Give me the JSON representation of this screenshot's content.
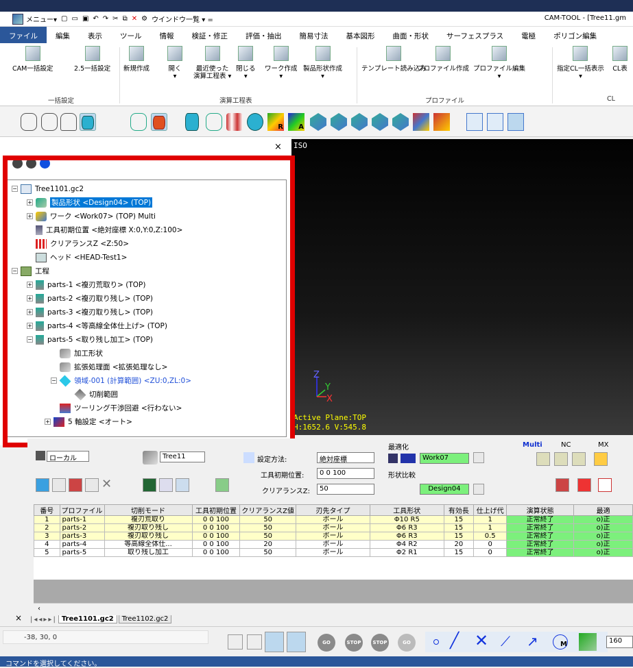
{
  "window": {
    "title": "CAM-TOOL - [Tree11.gm",
    "quick_access": [
      "メニュー▾",
      "ウインドウ一覧 ▾ ="
    ]
  },
  "ribbon": {
    "tabs": [
      "ファイル",
      "編集",
      "表示",
      "ツール",
      "情報",
      "検証・修正",
      "評価・抽出",
      "簡易寸法",
      "基本図形",
      "曲面・形状",
      "サーフェスプラス",
      "電極",
      "ポリゴン編集"
    ],
    "active_tab": "ファイル",
    "buttons": [
      {
        "label": "CAM一括設定",
        "label2": ""
      },
      {
        "label": "2.5一括設定",
        "label2": ""
      },
      {
        "label": "新規作成",
        "label2": ""
      },
      {
        "label": "開く",
        "label2": "▾"
      },
      {
        "label": "最近使った",
        "label2": "演算工程表 ▾"
      },
      {
        "label": "閉じる",
        "label2": "▾"
      },
      {
        "label": "ワーク作成",
        "label2": "▾"
      },
      {
        "label": "製品形状作成",
        "label2": "▾"
      },
      {
        "label": "テンプレート読み込み",
        "label2": ""
      },
      {
        "label": "プロファイル作成",
        "label2": ""
      },
      {
        "label": "プロファイル編集",
        "label2": "▾"
      },
      {
        "label": "指定CL一括表示",
        "label2": "▾"
      },
      {
        "label": "CL表",
        "label2": ""
      }
    ],
    "groups": [
      "一括設定",
      "演算工程表",
      "プロファイル",
      "CL"
    ]
  },
  "toolbar2_labels": [
    "R",
    "A"
  ],
  "tree_panel": {
    "close": "×",
    "nodes": [
      {
        "text": "Tree1101.gc2"
      },
      {
        "text": "製品形状 <Design04> (TOP)"
      },
      {
        "text": "ワーク <Work07> (TOP) Multi"
      },
      {
        "text": "工具初期位置 <絶対座標 X:0,Y:0,Z:100>"
      },
      {
        "text": "クリアランスZ <Z:50>"
      },
      {
        "text": "ヘッド <HEAD-Test1>"
      },
      {
        "text": "工程"
      },
      {
        "text": "parts-1 <複刃荒取り> (TOP)"
      },
      {
        "text": "parts-2 <複刃取り残し> (TOP)"
      },
      {
        "text": "parts-3 <複刃取り残し> (TOP)"
      },
      {
        "text": "parts-4 <等高線全体仕上げ> (TOP)"
      },
      {
        "text": "parts-5 <取り残し加工> (TOP)"
      },
      {
        "text": "加工形状"
      },
      {
        "text": "拡張処理面 <拡張処理なし>"
      },
      {
        "text": "領域-001 (計算範囲) <ZU:0,ZL:0>"
      },
      {
        "text": "切削範囲"
      },
      {
        "text": "ツーリング干渉回避 <行わない>"
      },
      {
        "text": "5 軸設定 <オート>"
      }
    ]
  },
  "viewport": {
    "view_name": "ISO",
    "plane_text": "Active Plane:TOP",
    "hv_text": "H:1652.6 V:545.8",
    "axis_x": "X",
    "axis_y": "Y",
    "axis_z": "Z"
  },
  "bottom": {
    "coord_system": "ローカル",
    "shape_name": "Tree11",
    "settings_method_label": "設定方法:",
    "settings_method_value": "絶対座標",
    "tool_init_label": "工具初期位置:",
    "tool_init_value": "0 0 100",
    "clearance_label": "クリアランスZ:",
    "clearance_value": "50",
    "optimize_label": "最適化",
    "work_value": "Work07",
    "compare_label": "形状比較",
    "design_value": "Design04",
    "multi_label": "Multi",
    "nc_label": "NC",
    "mx_label": "MX"
  },
  "table": {
    "headers": [
      "番号",
      "プロファイル",
      "切削モード",
      "工具初期位置",
      "クリアランスZ値",
      "刃先タイプ",
      "工具形状",
      "有効長",
      "仕上げ代",
      "演算状態",
      "最適"
    ],
    "rows": [
      [
        "1",
        "parts-1",
        "複刃荒取り",
        "0 0 100",
        "50",
        "ボール",
        "Φ10 R5",
        "15",
        "1",
        "正常終了",
        "o)正"
      ],
      [
        "2",
        "parts-2",
        "複刃取り残し",
        "0 0 100",
        "50",
        "ボール",
        "Φ6 R3",
        "15",
        "1",
        "正常終了",
        "o)正"
      ],
      [
        "3",
        "parts-3",
        "複刃取り残し",
        "0 0 100",
        "50",
        "ボール",
        "Φ6 R3",
        "15",
        "0.5",
        "正常終了",
        "o)正"
      ],
      [
        "4",
        "parts-4",
        "等高線全体仕...",
        "0 0 100",
        "20",
        "ボール",
        "Φ4 R2",
        "20",
        "0",
        "正常終了",
        "o)正"
      ],
      [
        "5",
        "parts-5",
        "取り残し加工",
        "0 0 100",
        "50",
        "ボール",
        "Φ2 R1",
        "15",
        "0",
        "正常終了",
        "o)正"
      ]
    ]
  },
  "sheet_tabs": [
    "Tree1101.gc2",
    "Tree1102.gc2"
  ],
  "statusbar": {
    "coordinates": "-38, 30, 0",
    "buttons": [
      "GO",
      "STOP",
      "STOP",
      "GO"
    ],
    "zoom": "160",
    "message": "コマンドを選択してください。"
  }
}
